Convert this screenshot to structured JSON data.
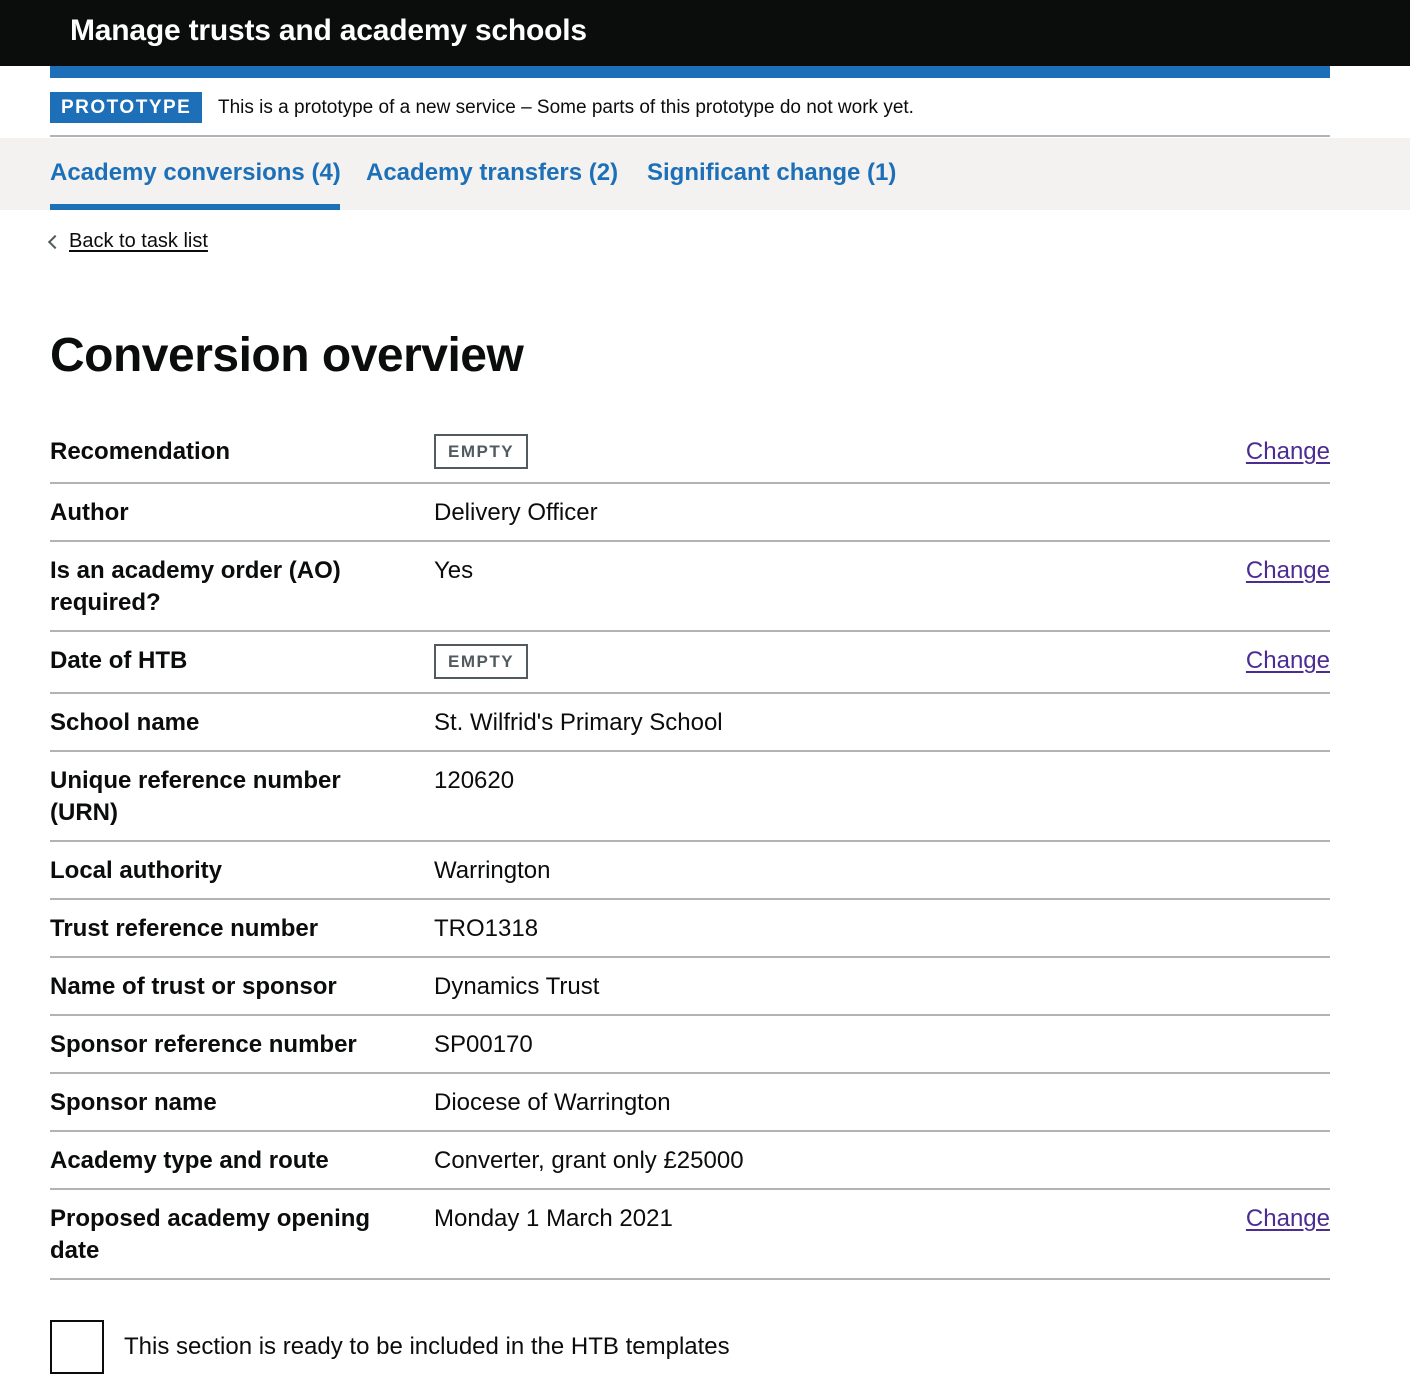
{
  "header": {
    "title": "Manage trusts and academy schools"
  },
  "phase_banner": {
    "tag": "PROTOTYPE",
    "text": "This is a prototype of a new service – Some parts of this prototype do not work yet."
  },
  "tabs": [
    {
      "label": "Academy conversions (4)",
      "active": true
    },
    {
      "label": "Academy transfers (2)",
      "active": false
    },
    {
      "label": "Significant change (1)",
      "active": false
    }
  ],
  "back_link": {
    "label": "Back to task list"
  },
  "page": {
    "title": "Conversion overview"
  },
  "summary": {
    "change_label": "Change",
    "empty_label": "EMPTY",
    "rows": [
      {
        "key": "Recomendation",
        "value": "",
        "empty": true,
        "change": true
      },
      {
        "key": "Author",
        "value": "Delivery Officer",
        "empty": false,
        "change": false
      },
      {
        "key": "Is an academy order (AO) required?",
        "value": "Yes",
        "empty": false,
        "change": true
      },
      {
        "key": "Date of HTB",
        "value": "",
        "empty": true,
        "change": true
      },
      {
        "key": "School name",
        "value": "St. Wilfrid's Primary School",
        "empty": false,
        "change": false
      },
      {
        "key": "Unique reference number (URN)",
        "value": "120620",
        "empty": false,
        "change": false
      },
      {
        "key": "Local authority",
        "value": "Warrington",
        "empty": false,
        "change": false
      },
      {
        "key": "Trust reference number",
        "value": "TRO1318",
        "empty": false,
        "change": false
      },
      {
        "key": "Name of trust or sponsor",
        "value": "Dynamics Trust",
        "empty": false,
        "change": false
      },
      {
        "key": "Sponsor reference number",
        "value": "SP00170",
        "empty": false,
        "change": false
      },
      {
        "key": "Sponsor name",
        "value": "Diocese of Warrington",
        "empty": false,
        "change": false
      },
      {
        "key": "Academy type and route",
        "value": "Converter, grant only £25000",
        "empty": false,
        "change": false
      },
      {
        "key": "Proposed academy opening date",
        "value": "Monday 1 March 2021",
        "empty": false,
        "change": true
      }
    ]
  },
  "checkbox": {
    "label": "This section is ready to be included in the HTB templates",
    "checked": false
  },
  "colors": {
    "header": "#0b0c0c",
    "brand_blue": "#1d70b8",
    "link_visited": "#4c2c92",
    "border": "#b1b4b6",
    "tabs_bg": "#f3f2f1"
  }
}
